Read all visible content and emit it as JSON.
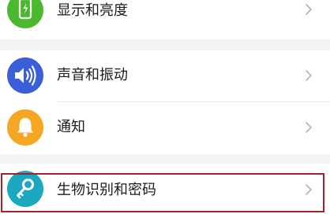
{
  "settings": {
    "items": [
      {
        "label": "显示和亮度",
        "icon": "phone-brightness-icon",
        "icon_color": "#4cb830"
      },
      {
        "label": "声音和振动",
        "icon": "speaker-volume-icon",
        "icon_color": "#3a5fd9"
      },
      {
        "label": "通知",
        "icon": "bell-icon",
        "icon_color": "#f5a623"
      },
      {
        "label": "生物识别和密码",
        "icon": "key-icon",
        "icon_color": "#1aa7bf"
      }
    ]
  },
  "highlight": {
    "target": "生物识别和密码",
    "color": "#a3212a"
  }
}
